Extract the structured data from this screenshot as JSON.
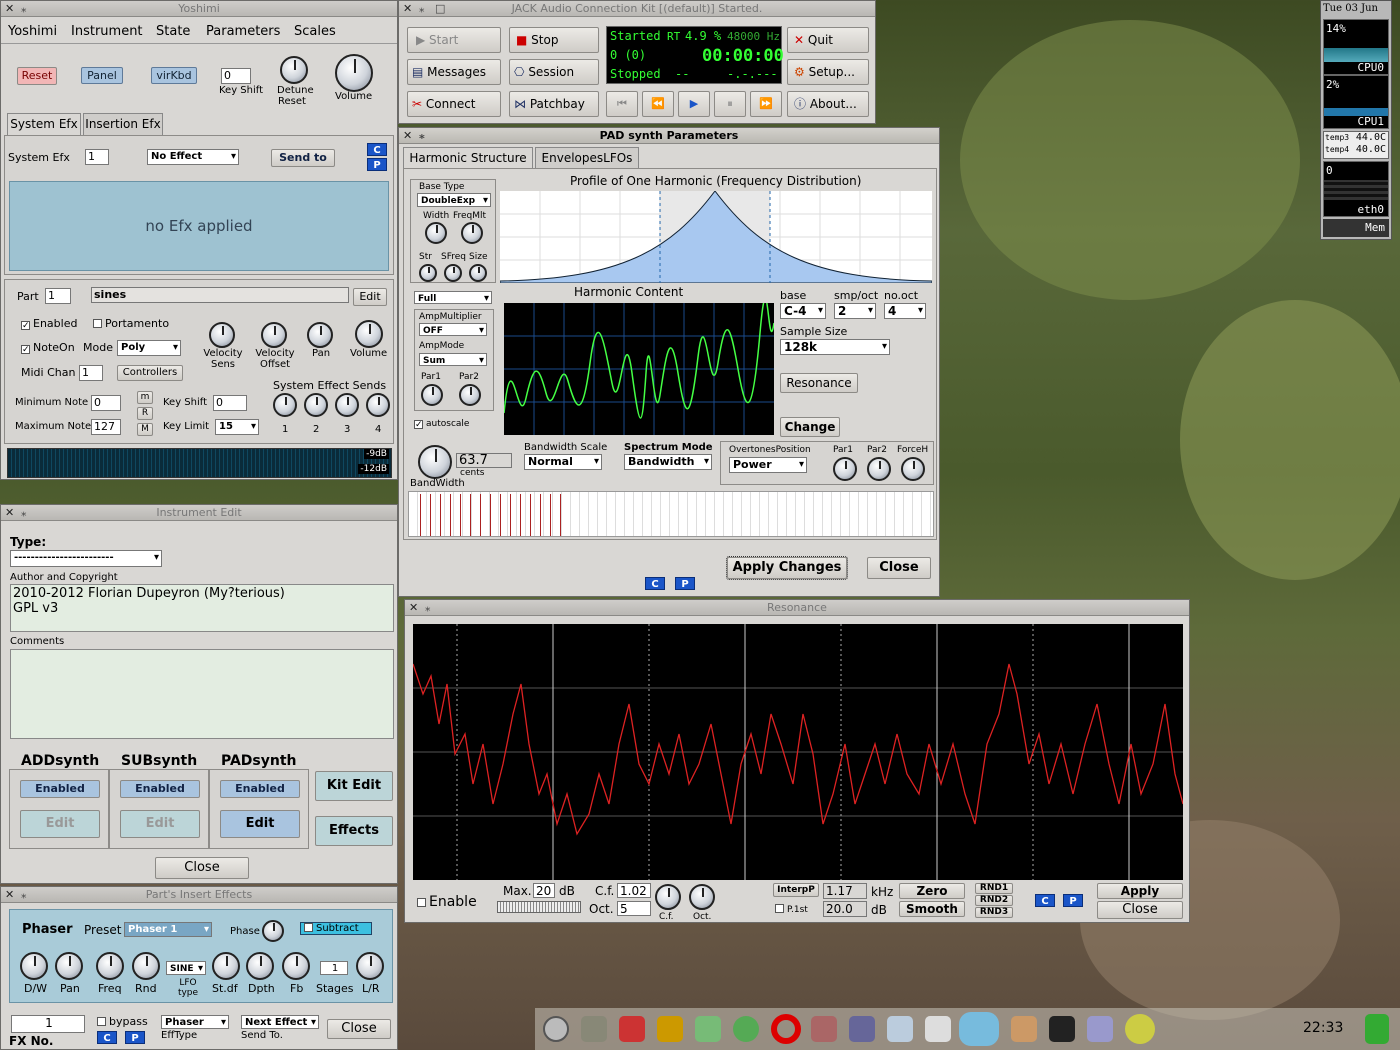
{
  "yoshimi": {
    "title": "Yoshimi",
    "menu": [
      "Yoshimi",
      "Instrument",
      "State",
      "Parameters",
      "Scales"
    ],
    "buttons": {
      "reset": "Reset",
      "panel": "Panel",
      "virkbd": "virKbd"
    },
    "key_shift_value": "0",
    "key_shift_label": "Key Shift",
    "detune_label": "Detune",
    "detune_reset": "Reset",
    "volume_label": "Volume",
    "tabs": [
      "System Efx",
      "Insertion Efx"
    ],
    "sys_efx_label": "System Efx",
    "sys_efx_num": "1",
    "effect_select": "No Effect",
    "send_to": "Send to",
    "c": "C",
    "p": "P",
    "no_efx": "no Efx applied",
    "part_label": "Part",
    "part_num": "1",
    "part_name": "sines",
    "edit": "Edit",
    "enabled": "Enabled",
    "portamento": "Portamento",
    "noteon": "NoteOn",
    "mode_label": "Mode",
    "mode_value": "Poly",
    "midi_chan_label": "Midi Chan",
    "midi_chan_value": "1",
    "controllers": "Controllers",
    "knobs": [
      "Velocity Sens",
      "Velocity Offset",
      "Pan",
      "Volume"
    ],
    "sends_label": "System Effect Sends",
    "sends": [
      "1",
      "2",
      "3",
      "4"
    ],
    "min_note_label": "Minimum Note",
    "min_note": "0",
    "max_note_label": "Maximum Note",
    "max_note": "127",
    "m": "m",
    "r": "R",
    "M": "M",
    "key_shift2_label": "Key Shift",
    "key_shift2": "0",
    "key_limit_label": "Key Limit",
    "key_limit": "15",
    "vu": [
      "-9dB",
      "-12dB"
    ]
  },
  "instrument_edit": {
    "title": "Instrument Edit",
    "type_label": "Type:",
    "type_value": "------------------------",
    "author_label": "Author and Copyright",
    "author_lines": [
      "2010-2012 Florian Dupeyron (My?terious)",
      "GPL v3"
    ],
    "comments_label": "Comments",
    "synths": [
      "ADDsynth",
      "SUBsynth",
      "PADsynth"
    ],
    "enabled": "Enabled",
    "edit": "Edit",
    "kit_edit": "Kit Edit",
    "effects": "Effects",
    "close": "Close"
  },
  "insert_effects": {
    "title": "Part's Insert Effects",
    "name": "Phaser",
    "preset_label": "Preset",
    "preset_value": "Phaser 1",
    "phase_label": "Phase",
    "subtract": "Subtract",
    "knobs": [
      "D/W",
      "Pan",
      "Freq",
      "Rnd",
      "LFO type",
      "St.df",
      "Dpth",
      "Fb",
      "Stages",
      "L/R"
    ],
    "lfo_value": "SINE",
    "stages_value": "1",
    "fx_num": "1",
    "bypass": "bypass",
    "efftype_value": "Phaser",
    "efftype_label": "EffType",
    "next_effect": "Next Effect",
    "sendto_label": "Send To.",
    "close": "Close",
    "fx_no": "FX No.",
    "c": "C",
    "p": "P"
  },
  "jack": {
    "title": "JACK Audio Connection Kit [(default)] Started.",
    "start": "Start",
    "stop": "Stop",
    "quit": "Quit",
    "messages": "Messages",
    "session": "Session",
    "setup": "Setup...",
    "connect": "Connect",
    "patchbay": "Patchbay",
    "about": "About...",
    "status": {
      "state": "Started",
      "rt": "RT",
      "dsp": "4.9 %",
      "rate": "48000 Hz",
      "xruns": "0 (0)",
      "time": "00:00:00",
      "transport": "Stopped",
      "dash": "--",
      "bbt": "-.-.---"
    }
  },
  "pad": {
    "title": "PAD synth Parameters",
    "tabs": [
      "Harmonic Structure",
      "EnvelopesLFOs"
    ],
    "base_type_label": "Base Type",
    "base_type": "DoubleExp",
    "width_label": "Width",
    "freqmlt_label": "FreqMlt",
    "str_label": "Str",
    "sfreq_label": "SFreq",
    "size_label": "Size",
    "full": "Full",
    "ampmult_label": "AmpMultiplier",
    "ampmult": "OFF",
    "ampmode_label": "AmpMode",
    "ampmode": "Sum",
    "par1": "Par1",
    "par2": "Par2",
    "autoscale": "autoscale",
    "profile_title": "Profile of One Harmonic (Frequency Distribution)",
    "harm_title": "Harmonic Content",
    "base_label": "base",
    "base_value": "C-4",
    "smpoct_label": "smp/oct",
    "smpoct": "2",
    "nooct_label": "no.oct",
    "nooct": "4",
    "sample_size_label": "Sample Size",
    "sample_size": "128k",
    "resonance": "Resonance",
    "change": "Change",
    "bw_value": "63.7",
    "cents": "cents",
    "bandwidth": "BandWidth",
    "bw_scale_label": "Bandwidth Scale",
    "bw_scale": "Normal",
    "spectrum_label": "Spectrum Mode",
    "spectrum": "Bandwidth",
    "overtones_label": "OvertonesPosition",
    "overtones": "Power",
    "forceh": "ForceH",
    "apply": "Apply Changes",
    "close": "Close",
    "c": "C",
    "p": "P"
  },
  "resonance": {
    "title": "Resonance",
    "enable": "Enable",
    "max_label": "Max.",
    "max_value": "20",
    "db": "dB",
    "cf_label": "C.f.",
    "cf_value": "1.02",
    "oct_label": "Oct.",
    "oct_value": "5",
    "cf_knob": "C.f.",
    "oct_knob": "Oct.",
    "interp": "InterpP",
    "p1st": "P.1st",
    "khz_value": "1.17",
    "khz": "kHz",
    "db_value": "20.0",
    "zero": "Zero",
    "smooth": "Smooth",
    "rnd": [
      "RND1",
      "RND2",
      "RND3"
    ],
    "c": "C",
    "p": "P",
    "apply": "Apply",
    "close": "Close"
  },
  "monitor": {
    "date": "Tue 03 Jun",
    "cpu0_pct": "14%",
    "cpu0": "CPU0",
    "cpu1_pct": "2%",
    "cpu1": "CPU1",
    "temp_labels": [
      "temp3",
      "temp4"
    ],
    "temps": [
      "44.0C",
      "40.0C"
    ],
    "net_val": "0",
    "eth": "eth0",
    "mem": "Mem"
  },
  "taskbar": {
    "clock": "22:33"
  }
}
